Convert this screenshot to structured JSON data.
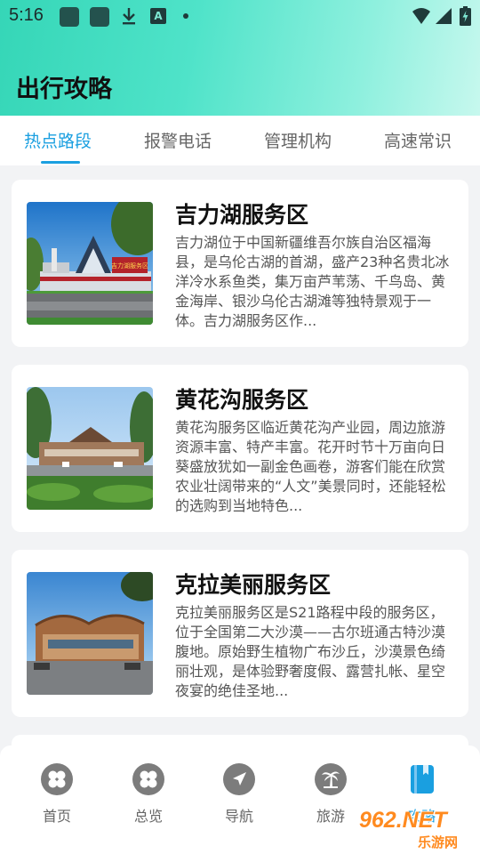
{
  "status_bar": {
    "time": "5:16",
    "a_badge": "A"
  },
  "header": {
    "title": "出行攻略"
  },
  "tabs": [
    {
      "label": "热点路段",
      "active": true
    },
    {
      "label": "报警电话",
      "active": false
    },
    {
      "label": "管理机构",
      "active": false
    },
    {
      "label": "高速常识",
      "active": false
    }
  ],
  "cards": [
    {
      "title": "吉力湖服务区",
      "description": "吉力湖位于中国新疆维吾尔族自治区福海县，是乌伦古湖的首湖，盛产23种名贵北冰洋冷水系鱼类，集万亩芦苇荡、千鸟岛、黄金海岸、银沙乌伦古湖滩等独特景观于一体。吉力湖服务区作...",
      "sign_text": "吉力湖服务区"
    },
    {
      "title": "黄花沟服务区",
      "description": "黄花沟服务区临近黄花沟产业园，周边旅游资源丰富、特产丰富。花开时节十万亩向日葵盛放犹如一副金色画卷，游客们能在欣赏农业壮阔带来的“人文”美景同时，还能轻松的选购到当地特色..."
    },
    {
      "title": "克拉美丽服务区",
      "description": "克拉美丽服务区是S21路程中段的服务区，位于全国第二大沙漠——古尔班通古特沙漠腹地。原始野生植物广布沙丘，沙漠景色绮丽壮观，是体验野奢度假、露营扎帐、星空夜宴的绝佳圣地..."
    }
  ],
  "bottom_nav": [
    {
      "label": "首页",
      "icon": "clover-icon",
      "active": false
    },
    {
      "label": "总览",
      "icon": "clover-icon",
      "active": false
    },
    {
      "label": "导航",
      "icon": "navigation-arrow-icon",
      "active": false
    },
    {
      "label": "旅游",
      "icon": "palm-tree-icon",
      "active": false
    },
    {
      "label": "攻略",
      "icon": "book-icon",
      "active": true
    }
  ],
  "watermark": {
    "line1": "962.NET",
    "line2": "乐游网"
  },
  "colors": {
    "accent": "#1a9fe0",
    "header_gradient_start": "#35d6b7",
    "header_gradient_end": "#c7f8ee"
  }
}
